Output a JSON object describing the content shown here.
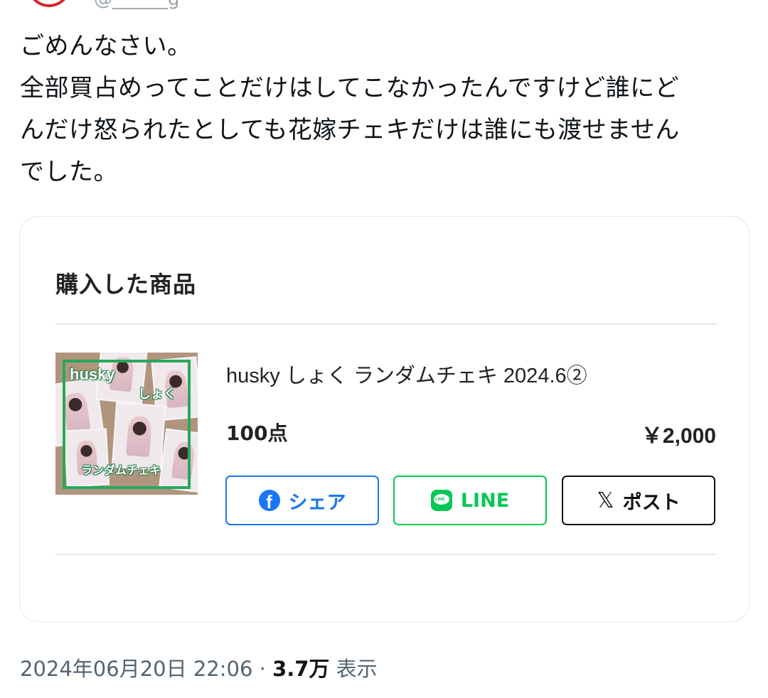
{
  "header": {
    "handle": "@______g"
  },
  "tweet": {
    "text": "ごめんなさい。\n全部買占めってことだけはしてこなかったんですけど誰にど\nんだけ怒られたとしても花嫁チェキだけは誰にも渡せません\nでした。"
  },
  "card": {
    "title": "購入した商品",
    "product": {
      "name": "husky しょく ランダムチェキ 2024.6②",
      "quantity": "100点",
      "price": "￥2,000",
      "thumbnail_text": {
        "husky": "husky",
        "shoku": "しょく",
        "random": "ランダムチェキ"
      }
    },
    "share": {
      "facebook_label": "シェア",
      "line_label": "LINE",
      "x_label": "ポスト"
    }
  },
  "meta": {
    "timestamp": "2024年06月20日 22:06",
    "separator": "·",
    "views_count": "3.7万",
    "views_label": "表示"
  },
  "colors": {
    "facebook": "#1877f2",
    "line": "#06c755",
    "x": "#111111",
    "thumbnail_frame": "#27a85c"
  }
}
